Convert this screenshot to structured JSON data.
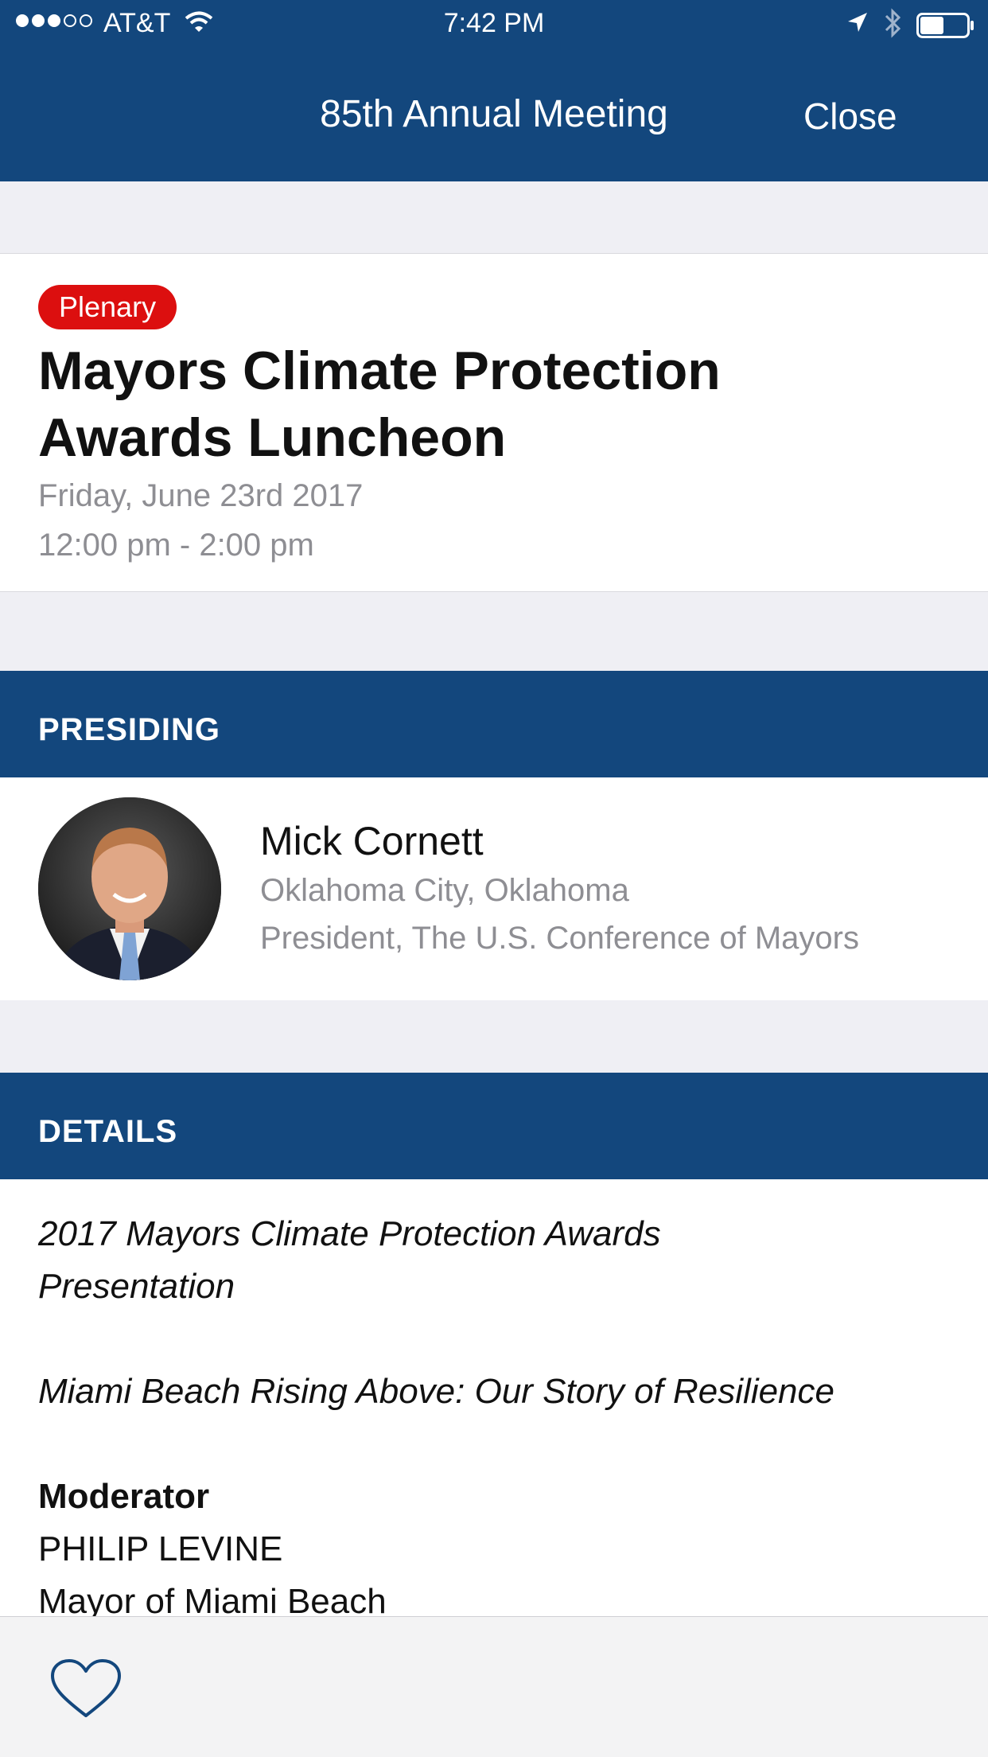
{
  "status_bar": {
    "carrier": "AT&T",
    "time": "7:42 PM",
    "signal_bars_filled": 3,
    "signal_bars_total": 5,
    "battery_level": 0.5
  },
  "nav": {
    "title": "85th Annual Meeting",
    "close_label": "Close"
  },
  "event": {
    "badge": "Plenary",
    "title": "Mayors Climate Protection Awards Luncheon",
    "date": "Friday, June 23rd 2017",
    "time": "12:00 pm - 2:00 pm"
  },
  "presiding": {
    "header": "PRESIDING",
    "name": "Mick Cornett",
    "location": "Oklahoma City, Oklahoma",
    "role": "President, The U.S. Conference of Mayors"
  },
  "details": {
    "header": "DETAILS",
    "line1": "2017 Mayors Climate Protection Awards Presentation",
    "line2": "Miami Beach Rising Above: Our Story of Resilience",
    "moderator_label": "Moderator",
    "moderator_name": "PHILIP LEVINE",
    "moderator_title": "Mayor of Miami Beach"
  },
  "colors": {
    "nav_blue": "#13477d",
    "badge_red": "#dc0f0f",
    "secondary_text": "#8e8e93"
  },
  "icons": {
    "favorite": "heart-outline-icon",
    "location": "location-arrow-icon",
    "bluetooth": "bluetooth-icon",
    "wifi": "wifi-icon",
    "battery": "battery-icon"
  }
}
